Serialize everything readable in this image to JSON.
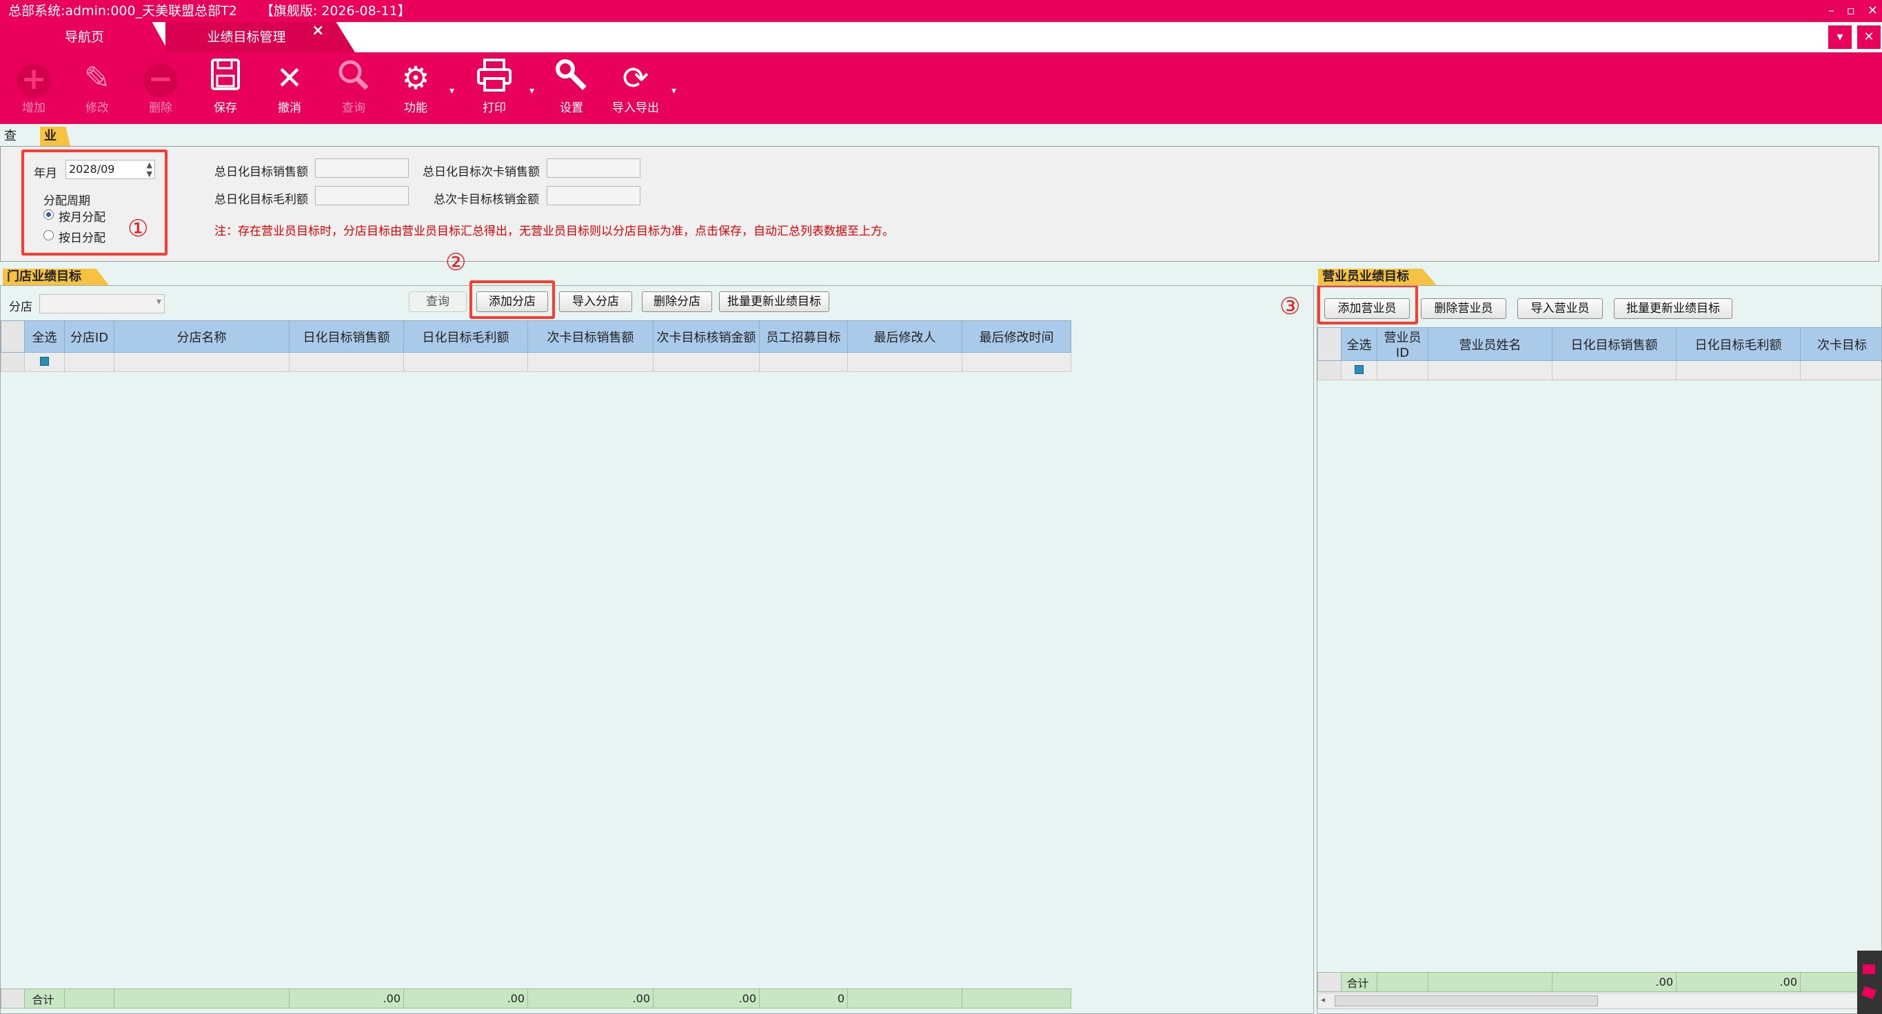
{
  "window": {
    "title": "总部系统:admin:000_天美联盟总部T2",
    "edition": "【旗舰版: 2026-08-11】"
  },
  "tabs": [
    {
      "label": "导航页"
    },
    {
      "label": "业绩目标管理"
    }
  ],
  "toolbar": {
    "items": [
      {
        "label": "增加",
        "icon": "add-icon"
      },
      {
        "label": "修改",
        "icon": "edit-icon"
      },
      {
        "label": "删除",
        "icon": "delete-icon"
      },
      {
        "label": "保存",
        "icon": "save-icon"
      },
      {
        "label": "撤消",
        "icon": "cancel-icon"
      },
      {
        "label": "查询",
        "icon": "search-icon"
      },
      {
        "label": "功能",
        "icon": "gear-icon"
      },
      {
        "label": "打印",
        "icon": "print-icon"
      },
      {
        "label": "设置",
        "icon": "wrench-icon"
      },
      {
        "label": "导入导出",
        "icon": "refresh-icon"
      }
    ]
  },
  "subtabs": [
    {
      "label": "查询"
    },
    {
      "label": "业绩明细"
    }
  ],
  "form": {
    "year_month_label": "年月",
    "year_month_value": "2028/09",
    "period_label": "分配周期",
    "period_options": [
      {
        "label": "按月分配",
        "selected": true
      },
      {
        "label": "按日分配",
        "selected": false
      }
    ],
    "total_daily_sales_label": "总日化目标销售额",
    "total_daily_card_sales_label": "总日化目标次卡销售额",
    "total_daily_profit_label": "总日化目标毛利额",
    "total_card_write_off_label": "总次卡目标核销金额",
    "note": "注：存在营业员目标时，分店目标由营业员目标汇总得出，无营业员目标则以分店目标为准，点击保存，自动汇总列表数据至上方。"
  },
  "markers": {
    "m1": "①",
    "m2": "②",
    "m3": "③"
  },
  "store_section": {
    "title": "门店业绩目标",
    "branch_label": "分店",
    "buttons": {
      "query": "查询",
      "add": "添加分店",
      "import": "导入分店",
      "delete": "删除分店",
      "batch": "批量更新业绩目标"
    },
    "columns": [
      "全选",
      "分店ID",
      "分店名称",
      "日化目标销售额",
      "日化目标毛利额",
      "次卡目标销售额",
      "次卡目标核销金额",
      "员工招募目标",
      "最后修改人",
      "最后修改时间"
    ],
    "footer": {
      "label": "合计",
      "sales": ".00",
      "profit": ".00",
      "card_sales": ".00",
      "card_write_off": ".00",
      "recruit": "0"
    }
  },
  "staff_section": {
    "title": "营业员业绩目标",
    "buttons": {
      "add": "添加营业员",
      "delete": "删除营业员",
      "import": "导入营业员",
      "batch": "批量更新业绩目标"
    },
    "columns": [
      "全选",
      "营业员ID",
      "营业员姓名",
      "日化目标销售额",
      "日化目标毛利额",
      "次卡目标"
    ],
    "footer": {
      "label": "合计",
      "sales": ".00",
      "profit": ".00"
    }
  },
  "colors": {
    "brand": "#e8005a",
    "header_cell": "#a9cbe9",
    "footer_row": "#c8e6c3",
    "highlight": "#ff3b30"
  }
}
